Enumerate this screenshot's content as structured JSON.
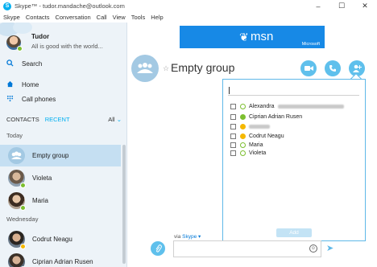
{
  "window": {
    "title": "Skype™ - tudor.mandache@outlook.com",
    "controls": [
      "minimize",
      "maximize",
      "close"
    ]
  },
  "menu": [
    "Skype",
    "Contacts",
    "Conversation",
    "Call",
    "View",
    "Tools",
    "Help"
  ],
  "profile": {
    "name": "Tudor",
    "mood": "All is good with the world..."
  },
  "nav": {
    "search": "Search",
    "home": "Home",
    "call_phones": "Call phones"
  },
  "tabs": {
    "contacts": "CONTACTS",
    "recent": "RECENT",
    "filter": "All"
  },
  "sections": {
    "today": "Today",
    "wednesday": "Wednesday"
  },
  "recent": [
    {
      "name": "Empty group",
      "selected": true
    },
    {
      "name": "Violeta"
    },
    {
      "name": "Maria"
    },
    {
      "name": "Codrut Neagu"
    },
    {
      "name": "Ciprian Adrian Rusen"
    }
  ],
  "ad": {
    "brand": "msn",
    "company": "Microsoft"
  },
  "conversation": {
    "title": "Empty group"
  },
  "add_people": {
    "search_value": "",
    "people": [
      {
        "name": "Alexandra",
        "status": "online",
        "checked": false,
        "redacted": true
      },
      {
        "name": "Ciprian Adrian Rusen",
        "status": "online-check",
        "checked": false
      },
      {
        "name": "",
        "status": "away",
        "checked": false,
        "redacted": true
      },
      {
        "name": "Codrut Neagu",
        "status": "away",
        "checked": false
      },
      {
        "name": "Maria",
        "status": "online",
        "checked": false
      },
      {
        "name": "Violeta",
        "status": "online",
        "checked": false
      }
    ],
    "add_label": "Add"
  },
  "compose": {
    "via_prefix": "via",
    "via_service": "Skype",
    "placeholder": ""
  },
  "colors": {
    "accent": "#00aff0",
    "button": "#5fc0ec",
    "selected_row": "#c5dff2",
    "sidebar_bg": "#edf3f8",
    "online": "#7cbf2f",
    "away": "#f5b800"
  }
}
